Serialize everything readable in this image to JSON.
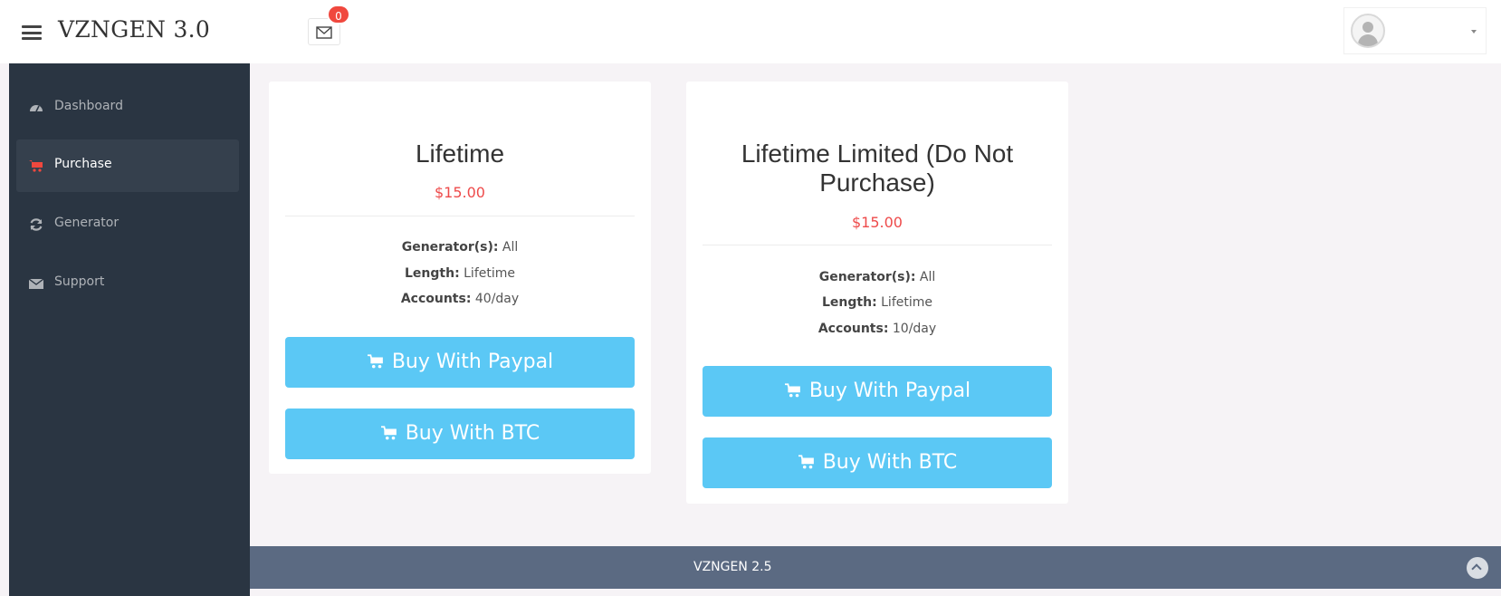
{
  "header": {
    "brand": "VZNGEN 3.0",
    "notifications_count": "0"
  },
  "sidebar": {
    "items": [
      {
        "label": "Dashboard"
      },
      {
        "label": "Purchase"
      },
      {
        "label": "Generator"
      },
      {
        "label": "Support"
      }
    ]
  },
  "plans": [
    {
      "title_line1": "Lifetime",
      "title_line2": "",
      "price": "$15.00",
      "generators_label": "Generator(s):",
      "generators_value": "All",
      "length_label": "Length:",
      "length_value": "Lifetime",
      "accounts_label": "Accounts:",
      "accounts_value": "40/day",
      "paypal_label": "Buy With Paypal",
      "btc_label": "Buy With BTC"
    },
    {
      "title_line1": "Lifetime Limited (Do Not",
      "title_line2": "Purchase)",
      "price": "$15.00",
      "generators_label": "Generator(s):",
      "generators_value": "All",
      "length_label": "Length:",
      "length_value": "Lifetime",
      "accounts_label": "Accounts:",
      "accounts_value": "10/day",
      "paypal_label": "Buy With Paypal",
      "btc_label": "Buy With BTC"
    }
  ],
  "footer": {
    "text": "VZNGEN 2.5"
  },
  "colors": {
    "sidebar_bg": "#2a3542",
    "button": "#5bc8f5",
    "price": "#ee4b4b",
    "footer_bg": "#5b6a82",
    "badge": "#f0483e"
  }
}
